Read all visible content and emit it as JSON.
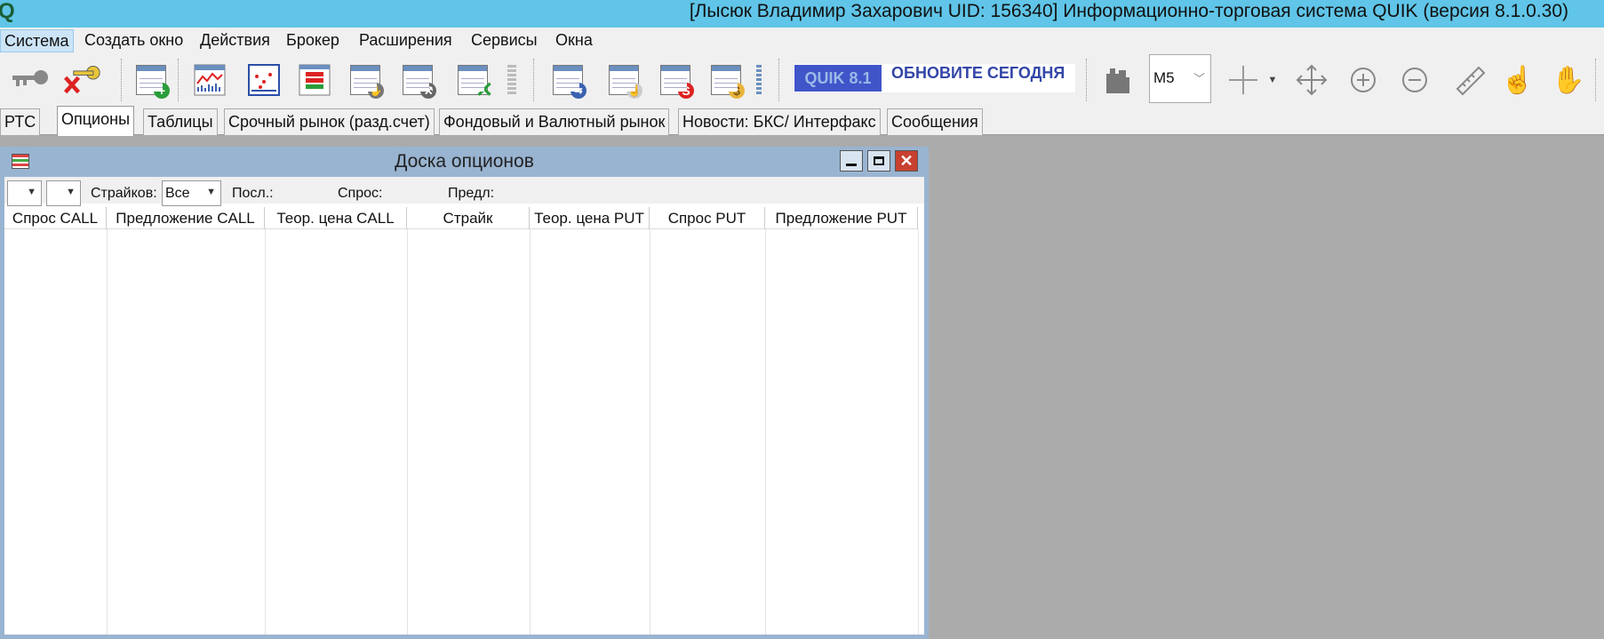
{
  "window": {
    "logo": "Q",
    "title": "[Лысюк Владимир Захарович UID: 156340] Информационно-торговая система QUIK (версия 8.1.0.30)"
  },
  "menu": [
    "Система",
    "Создать окно",
    "Действия",
    "Брокер",
    "Расширения",
    "Сервисы",
    "Окна"
  ],
  "toolbar": {
    "banner_logo": "QUIK 8.1",
    "banner_text": "ОБНОВИТЕ СЕГОДНЯ",
    "interval": "M5",
    "icons": [
      "key-icon",
      "disconnect-icon",
      "new-table-icon",
      "chart-icon",
      "scatter-chart-icon",
      "order-book-icon",
      "deal-icon",
      "settings-table-icon",
      "cancel-orders-icon",
      "trade-icon",
      "stop-order-icon",
      "money-icon",
      "crosshair-icon",
      "move-icon",
      "zoom-in-icon",
      "zoom-out-icon",
      "ruler-icon",
      "pointer-hand-icon",
      "grab-hand-icon"
    ]
  },
  "tabs": [
    "РТС",
    "Опционы",
    "Таблицы",
    "Срочный рынок (разд.счет)",
    "Фондовый и Валютный рынок",
    "Новости: БКС/ Интерфакс",
    "Сообщения"
  ],
  "board": {
    "title": "Доска опционов",
    "strikes_label": "Страйков:",
    "strikes_value": "Все",
    "last_label": "Посл.:",
    "bid_label": "Спрос:",
    "ask_label": "Предл:",
    "columns": [
      "Спрос CALL",
      "Предложение CALL",
      "Теор. цена CALL",
      "Страйк",
      "Теор. цена PUT",
      "Спрос PUT",
      "Предложение PUT"
    ]
  },
  "colors": {
    "titlebar": "#60c5e8",
    "accent": "#3f55c9",
    "subwindow_frame": "#99b4d1",
    "close": "#c8402f"
  }
}
